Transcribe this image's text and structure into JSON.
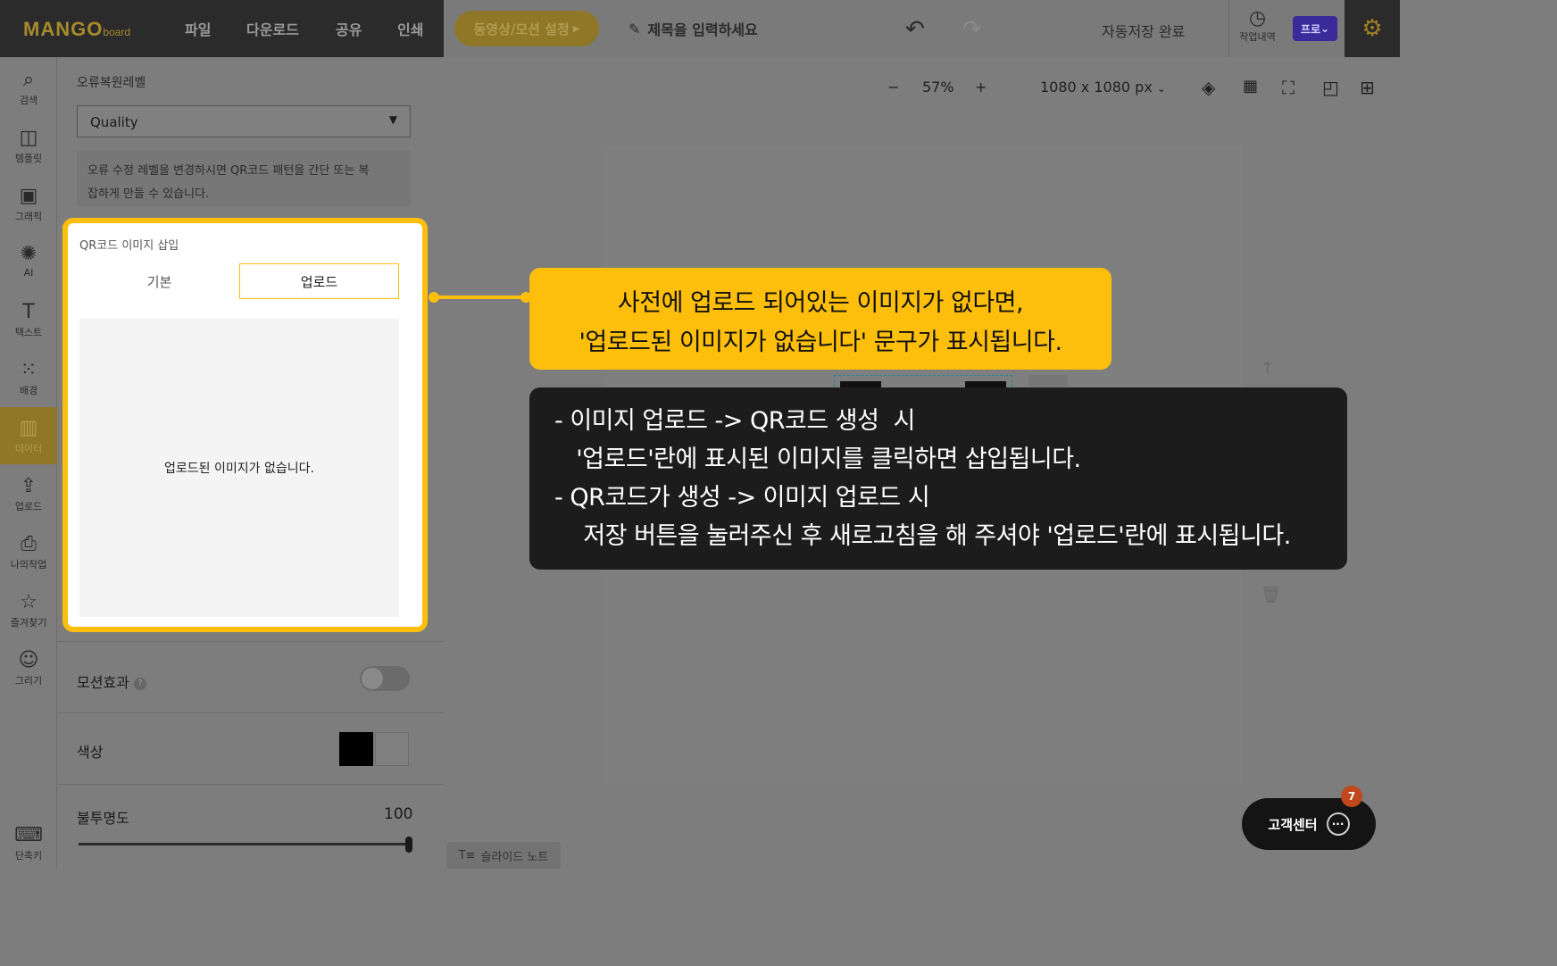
{
  "app": {
    "logo_main": "MANGO",
    "logo_sub": "board"
  },
  "topbar": {
    "menu": [
      "파일",
      "다운로드",
      "공유",
      "인쇄"
    ],
    "motion_button": "동영상/모션 설정",
    "title_placeholder": "제목을 입력하세요",
    "autosave": "자동저장 완료",
    "history_label": "작업내역",
    "pro_badge": "프로"
  },
  "sidebar": {
    "items": [
      {
        "label": "검색",
        "icon": "search-icon"
      },
      {
        "label": "템플릿",
        "icon": "template-icon"
      },
      {
        "label": "그래픽",
        "icon": "graphic-icon"
      },
      {
        "label": "AI",
        "icon": "ai-icon"
      },
      {
        "label": "텍스트",
        "icon": "text-icon"
      },
      {
        "label": "배경",
        "icon": "background-icon"
      },
      {
        "label": "데이터",
        "icon": "chart-icon",
        "active": true
      },
      {
        "label": "업로드",
        "icon": "upload-icon"
      },
      {
        "label": "나의작업",
        "icon": "my-work-icon"
      },
      {
        "label": "즐겨찾기",
        "icon": "star-icon"
      },
      {
        "label": "그리기",
        "icon": "draw-icon"
      }
    ],
    "shortcut_label": "단축키"
  },
  "panel": {
    "error_level_label": "오류복원레벨",
    "error_level_value": "Quality",
    "help_text_1": "오류 수정 레벨을 변경하시면 QR코드 패턴을 간단 또는 복",
    "help_text_2": "잡하게 만들 수 있습니다.",
    "qr_insert_title": "QR코드 이미지 삽입",
    "tab_basic": "기본",
    "tab_upload": "업로드",
    "empty_text": "업로드된 이미지가 없습니다.",
    "motion_label": "모션효과",
    "motion_help": "?",
    "color_label": "색상",
    "opacity_label": "불투명도",
    "opacity_value": "100"
  },
  "canvas": {
    "zoom": "57%",
    "zoom_minus": "−",
    "zoom_plus": "+",
    "size": "1080 x 1080 px"
  },
  "callouts": {
    "yellow_line1": "사전에 업로드 되어있는 이미지가 없다면,",
    "yellow_line2": "'업로드된 이미지가 없습니다' 문구가 표시됩니다.",
    "black_line1": "- 이미지 업로드 -> QR코드 생성  시",
    "black_line2": "   '업로드'란에 표시된 이미지를 클릭하면 삽입됩니다.",
    "black_line3": "- QR코드가 생성 -> 이미지 업로드 시",
    "black_line4": "    저장 버튼을 눌러주신 후 새로고침을 해 주셔야 '업로드'란에 표시됩니다."
  },
  "bottom": {
    "slide_note": "슬라이드 노트",
    "support": "고객센터",
    "support_badge": "7"
  },
  "colors": {
    "accent": "#fdbf0b",
    "dark": "#1c1c1c"
  }
}
